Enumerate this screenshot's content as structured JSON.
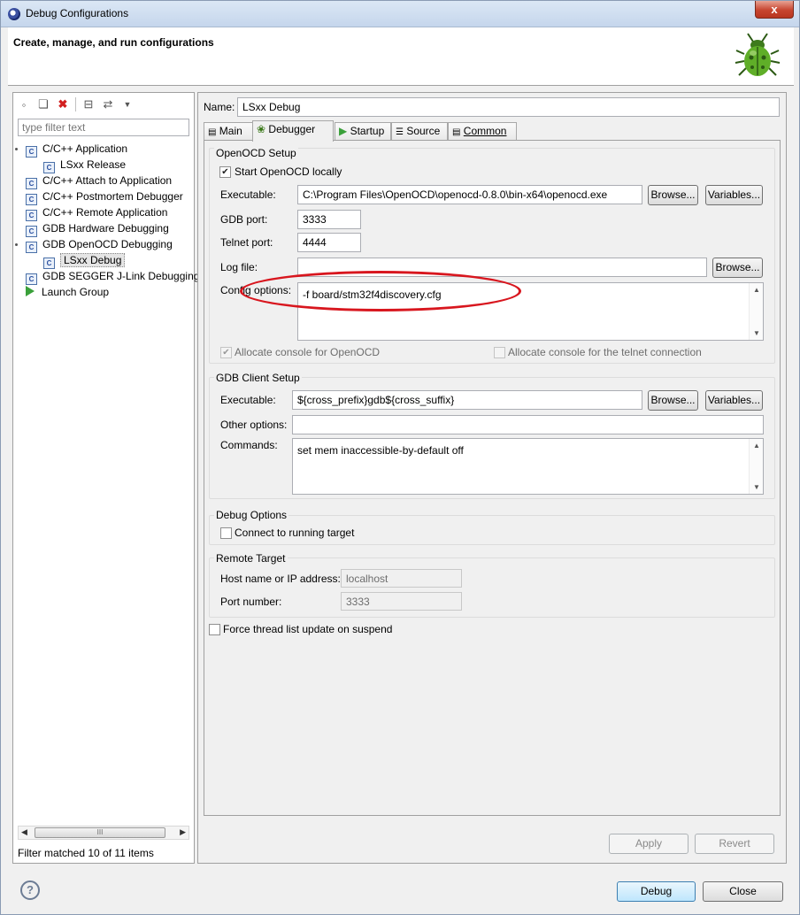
{
  "window": {
    "title": "Debug Configurations",
    "close": "x"
  },
  "header": {
    "title": "Create, manage, and run configurations"
  },
  "left": {
    "filter_placeholder": "type filter text",
    "tree": [
      {
        "label": "C/C++ Application",
        "level": 0
      },
      {
        "label": "LSxx Release",
        "level": 1
      },
      {
        "label": "C/C++ Attach to Application",
        "level": 0
      },
      {
        "label": "C/C++ Postmortem Debugger",
        "level": 0
      },
      {
        "label": "C/C++ Remote Application",
        "level": 0
      },
      {
        "label": "GDB Hardware Debugging",
        "level": 0
      },
      {
        "label": "GDB OpenOCD Debugging",
        "level": 0
      },
      {
        "label": "LSxx Debug",
        "level": 1
      },
      {
        "label": "GDB SEGGER J-Link Debugging",
        "level": 0
      },
      {
        "label": "Launch Group",
        "level": 0
      }
    ],
    "scroll_grip": "III",
    "status": "Filter matched 10 of 11 items"
  },
  "name": {
    "label": "Name:",
    "value": "LSxx Debug"
  },
  "tabs": {
    "main": "Main",
    "debugger": "Debugger",
    "startup": "Startup",
    "source": "Source",
    "common": "Common"
  },
  "openocd": {
    "title": "OpenOCD Setup",
    "start_locally": "Start OpenOCD locally",
    "executable_label": "Executable:",
    "executable_value": "C:\\Program Files\\OpenOCD\\openocd-0.8.0\\bin-x64\\openocd.exe",
    "gdb_port_label": "GDB port:",
    "gdb_port": "3333",
    "telnet_port_label": "Telnet port:",
    "telnet_port": "4444",
    "log_file_label": "Log file:",
    "log_file": "",
    "config_label": "Config options:",
    "config_value": "-f board/stm32f4discovery.cfg",
    "alloc_console": "Allocate console for OpenOCD",
    "alloc_telnet": "Allocate console for the telnet connection"
  },
  "gdbclient": {
    "title": "GDB Client Setup",
    "executable_label": "Executable:",
    "executable_value": "${cross_prefix}gdb${cross_suffix}",
    "other_label": "Other options:",
    "other_value": "",
    "commands_label": "Commands:",
    "commands_value": "set mem inaccessible-by-default off"
  },
  "debugopts": {
    "title": "Debug Options",
    "connect": "Connect to running target"
  },
  "remote": {
    "title": "Remote Target",
    "host_label": "Host name or IP address:",
    "host": "localhost",
    "port_label": "Port number:",
    "port": "3333"
  },
  "force_thread": "Force thread list update on suspend",
  "buttons": {
    "browse": "Browse...",
    "variables": "Variables...",
    "apply": "Apply",
    "revert": "Revert",
    "debug": "Debug",
    "close": "Close",
    "help": "?"
  }
}
